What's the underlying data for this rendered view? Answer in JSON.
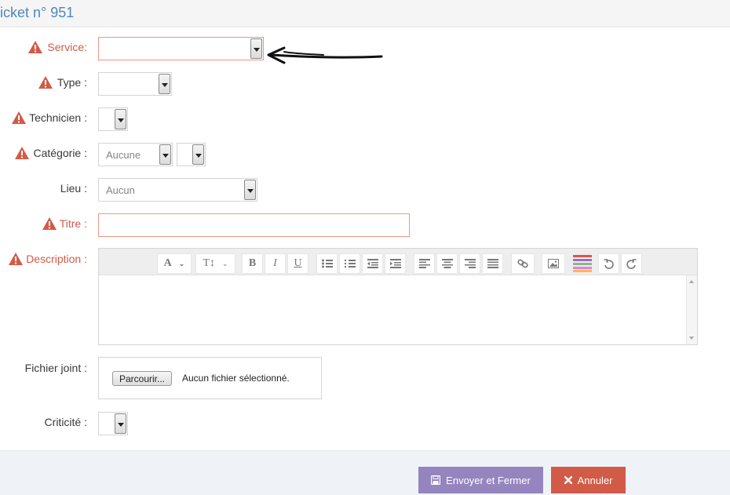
{
  "header": {
    "title": "icket n° 951"
  },
  "form": {
    "service_label": "Service:",
    "type_label": "Type :",
    "technicien_label": "Technicien :",
    "categorie_label": "Catégorie :",
    "categorie_value": "Aucune",
    "lieu_label": "Lieu :",
    "lieu_value": "Aucun",
    "titre_label": "Titre :",
    "description_label": "Description :",
    "fichier_label": "Fichier joint :",
    "fichier_button": "Parcourir...",
    "fichier_status": "Aucun fichier sélectionné.",
    "criticite_label": "Criticité :"
  },
  "toolbar": {
    "font_glyph": "A",
    "size_glyph": "T↕",
    "bold": "B",
    "italic": "I",
    "underline": "U"
  },
  "footer": {
    "send_label": "Envoyer et Fermer",
    "cancel_label": "Annuler"
  },
  "colors": {
    "required_label": "#d15b47",
    "warning_icon": "#d15b47",
    "header_title": "#4b89bd",
    "send_button": "#9585bf",
    "cancel_button": "#d15b47"
  }
}
